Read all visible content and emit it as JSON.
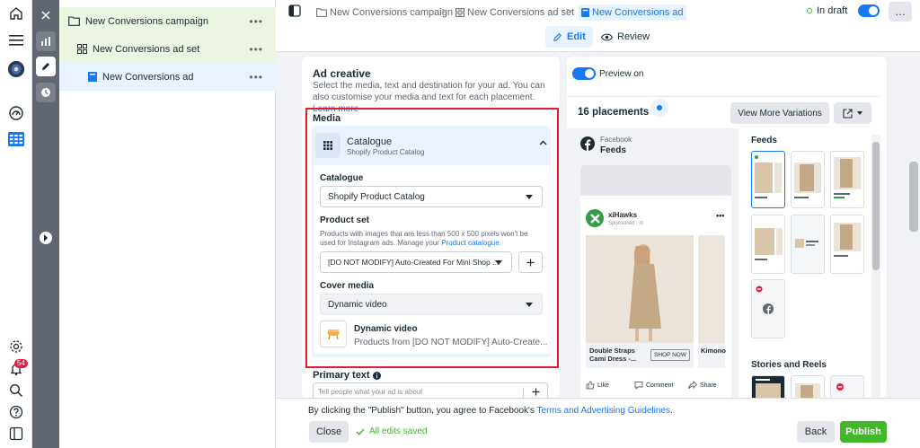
{
  "rail": {
    "notification_count": "54"
  },
  "tree": {
    "campaign": "New Conversions campaign",
    "adset": "New Conversions ad set",
    "ad": "New Conversions ad",
    "more": "•••"
  },
  "topbar": {
    "crumb_campaign": "New Conversions campaign",
    "crumb_adset": "New Conversions ad set",
    "crumb_ad": "New Conversions ad",
    "status": "In draft",
    "more": "…",
    "tab_edit": "Edit",
    "tab_review": "Review"
  },
  "editor": {
    "title": "Ad creative",
    "description": "Select the media, text and destination for your ad. You can also customise your media and text for each placement.",
    "learn_more": "Learn more",
    "media_label": "Media",
    "media_type": "Catalogue",
    "media_sub": "Shopify Product Catalog",
    "catalogue_label": "Catalogue",
    "catalogue_value": "Shopify Product Catalog",
    "product_set_label": "Product set",
    "product_set_help": "Products with images that are less than 500 x 500 pixels won't be used for Instagram ads. Manage your",
    "product_set_link": "Product catalogue",
    "product_set_value": "[DO NOT MODIFY] Auto-Created For Mini Shop ...",
    "cover_media_label": "Cover media",
    "cover_media_value": "Dynamic video",
    "dynamic_title": "Dynamic video",
    "dynamic_sub": "Products from [DO NOT MODIFY] Auto-Create...",
    "primary_text_label": "Primary text",
    "primary_text_placeholder": "Tell people what your ad is about"
  },
  "preview": {
    "toggle_label": "Preview on",
    "placements": "16 placements",
    "view_more": "View More Variations",
    "fb_label": "Facebook",
    "fb_feeds": "Feeds",
    "advertiser": "xiHawks",
    "sponsored": "Sponsored · ⊙",
    "product1": "Double Straps Cami Dress -...",
    "shop_now": "SHOP NOW",
    "product2": "Kimono",
    "like": "Like",
    "comment": "Comment",
    "share": "Share",
    "feeds_heading": "Feeds",
    "stories_heading": "Stories and Reels"
  },
  "bottombar": {
    "notice_prefix": "By clicking the \"Publish\" button, you agree to Facebook's",
    "notice_link": "Terms and Advertising Guidelines",
    "close": "Close",
    "saved": "All edits saved",
    "back": "Back",
    "publish": "Publish"
  },
  "colors": {
    "accent": "#1877f2",
    "publish": "#42b72a",
    "highlight": "#e21c2b",
    "status": "#42b72a"
  }
}
